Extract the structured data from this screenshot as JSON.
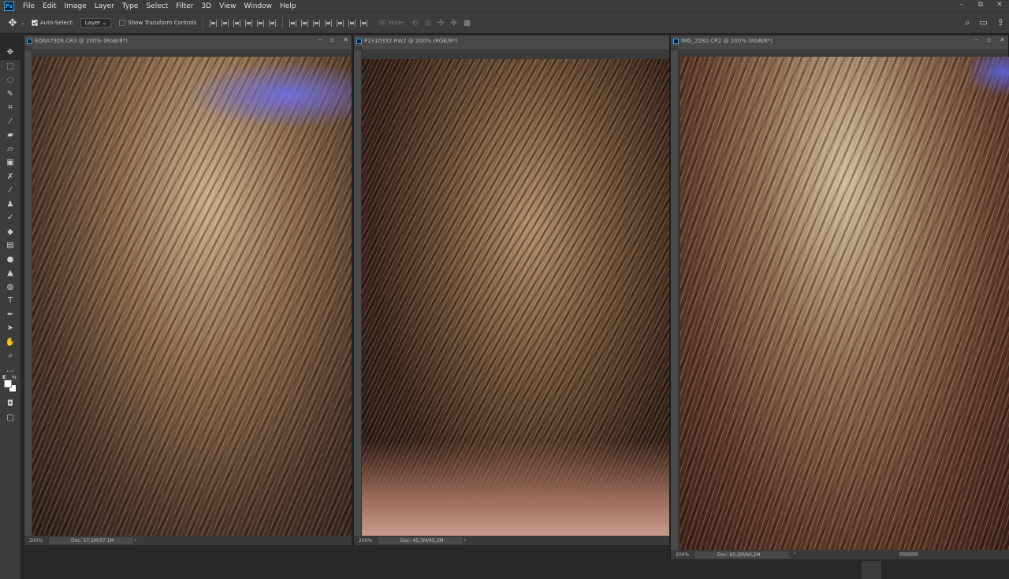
{
  "app": {
    "logo": "Ps"
  },
  "menu": [
    "File",
    "Edit",
    "Image",
    "Layer",
    "Type",
    "Select",
    "Filter",
    "3D",
    "View",
    "Window",
    "Help"
  ],
  "window_controls": {
    "minimize": "–",
    "restore": "⧉",
    "close": "✕"
  },
  "options_bar": {
    "auto_select_label": "Auto-Select:",
    "auto_select_checked": true,
    "target_value": "Layer",
    "transform_controls_label": "Show Transform Controls",
    "transform_controls_checked": false,
    "mode3d_label": "3D Mode:"
  },
  "tools": [
    "move-tool",
    "marquee-tool",
    "lasso-tool",
    "quick-selection-tool",
    "crop-tool",
    "eyedropper-tool",
    "healing-brush-tool",
    "brush-tool",
    "clone-stamp-tool",
    "history-brush-tool",
    "eraser-tool",
    "gradient-tool",
    "blur-tool",
    "dodge-tool",
    "pen-tool",
    "type-tool",
    "path-selection-tool",
    "rectangle-tool",
    "hand-tool",
    "zoom-tool",
    "more-tools"
  ],
  "colors": {
    "foreground": "#ffffff",
    "background": "#ffffff",
    "accent": "#31a8ff"
  },
  "documents": [
    {
      "title": "EQ6A7926.CR3 @ 200% (RGB/8*)",
      "zoom": "200%",
      "doc_info": "Doc: 57,1M/57,1M"
    },
    {
      "title": "P2310332.RW2 @ 200% (RGB/8*)",
      "zoom": "200%",
      "doc_info": "Doc: 45,3M/45,3M"
    },
    {
      "title": "IMG_2282.CR2 @ 200% (RGB/8*)",
      "zoom": "200%",
      "doc_info": "Doc: 60,2M/60,2M"
    }
  ]
}
